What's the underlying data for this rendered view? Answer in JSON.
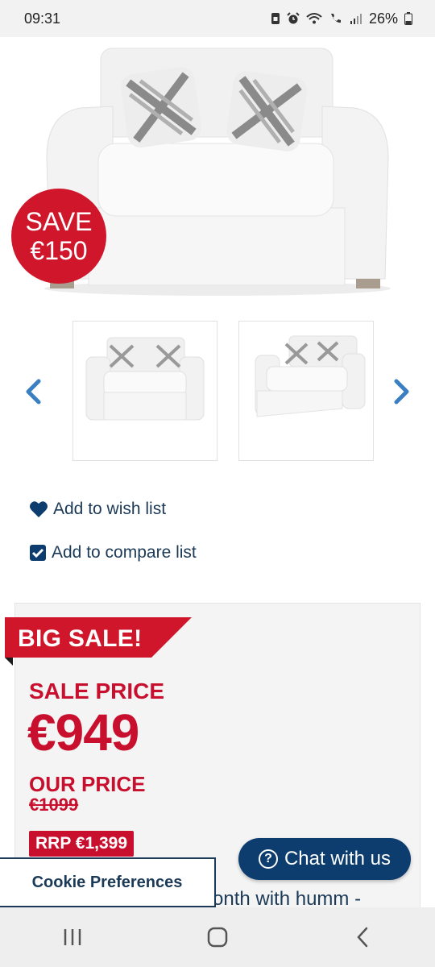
{
  "status_bar": {
    "time": "09:31",
    "battery": "26%",
    "icons": [
      "sim-icon",
      "alarm-icon",
      "wifi-icon",
      "call-icon",
      "signal-icon",
      "battery-icon"
    ]
  },
  "product": {
    "save_badge": {
      "line1": "SAVE",
      "line2": "€150"
    },
    "thumbnails": [
      "sofa-front-thumbnail",
      "sofa-angle-thumbnail"
    ]
  },
  "actions": {
    "wishlist": "Add to wish list",
    "compare": "Add to compare list"
  },
  "pricing": {
    "banner": "BIG SALE!",
    "sale_price_label": "SALE PRICE",
    "sale_price": "€949",
    "our_price_label": "OUR PRICE",
    "our_price": "€1099",
    "rrp": "RRP €1,399",
    "finance_text": "onth with humm -"
  },
  "chat": {
    "label": "Chat with us"
  },
  "cookie": {
    "label": "Cookie Preferences"
  },
  "colors": {
    "accent_red": "#c8102e",
    "navy": "#1b3a57",
    "chat_blue": "#0c3d6e",
    "arrow_blue": "#3a7fc1"
  }
}
